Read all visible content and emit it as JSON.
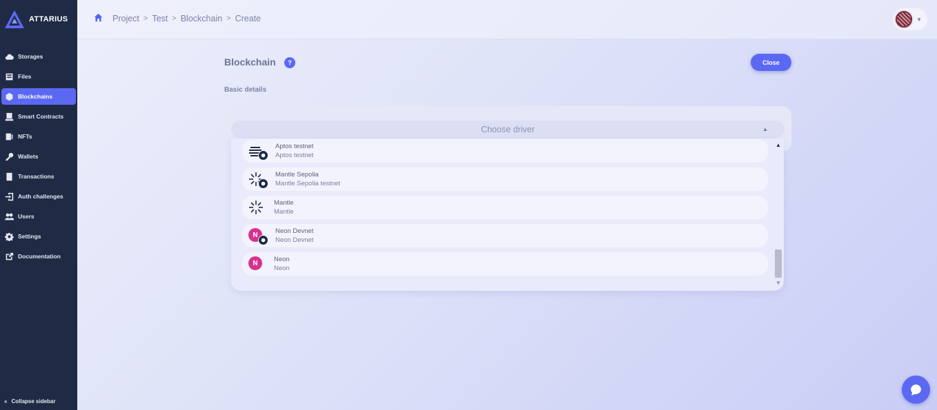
{
  "app": {
    "logo_text": "ATTARIUS"
  },
  "sidebar": {
    "items": [
      {
        "label": "Storages",
        "icon": "cloud-icon"
      },
      {
        "label": "Files",
        "icon": "file-icon"
      },
      {
        "label": "Blockchains",
        "icon": "cube-icon",
        "active": true
      },
      {
        "label": "Smart Contracts",
        "icon": "contract-icon"
      },
      {
        "label": "NFTs",
        "icon": "nft-icon"
      },
      {
        "label": "Wallets",
        "icon": "key-icon"
      },
      {
        "label": "Transactions",
        "icon": "transactions-icon"
      },
      {
        "label": "Auth challenges",
        "icon": "login-icon"
      },
      {
        "label": "Users",
        "icon": "users-icon"
      },
      {
        "label": "Settings",
        "icon": "gear-icon"
      },
      {
        "label": "Documentation",
        "icon": "external-link-icon"
      }
    ],
    "collapse_label": "Collapse sidebar"
  },
  "breadcrumb": [
    "Project",
    "Test",
    "Blockchain",
    "Create"
  ],
  "page": {
    "title": "Blockchain",
    "help_label": "?",
    "close_label": "Close",
    "section_label": "Basic details"
  },
  "driver_select": {
    "placeholder": "Choose driver",
    "options": [
      {
        "title": "Aptos testnet",
        "subtitle": "Aptos testnet",
        "icon": "aptos-icon",
        "testnet": true
      },
      {
        "title": "Mantle Sepolia",
        "subtitle": "Mantle Sepolia testnet",
        "icon": "mantle-icon",
        "testnet": true
      },
      {
        "title": "Mantle",
        "subtitle": "Mantle",
        "icon": "mantle-icon",
        "testnet": false
      },
      {
        "title": "Neon Devnet",
        "subtitle": "Neon Devnet",
        "icon": "neon-icon",
        "testnet": true
      },
      {
        "title": "Neon",
        "subtitle": "Neon",
        "icon": "neon-icon",
        "testnet": false
      }
    ]
  },
  "colors": {
    "accent": "#5b69f2",
    "sidebar_bg": "#1f2b45",
    "neon": "#d6328e"
  }
}
